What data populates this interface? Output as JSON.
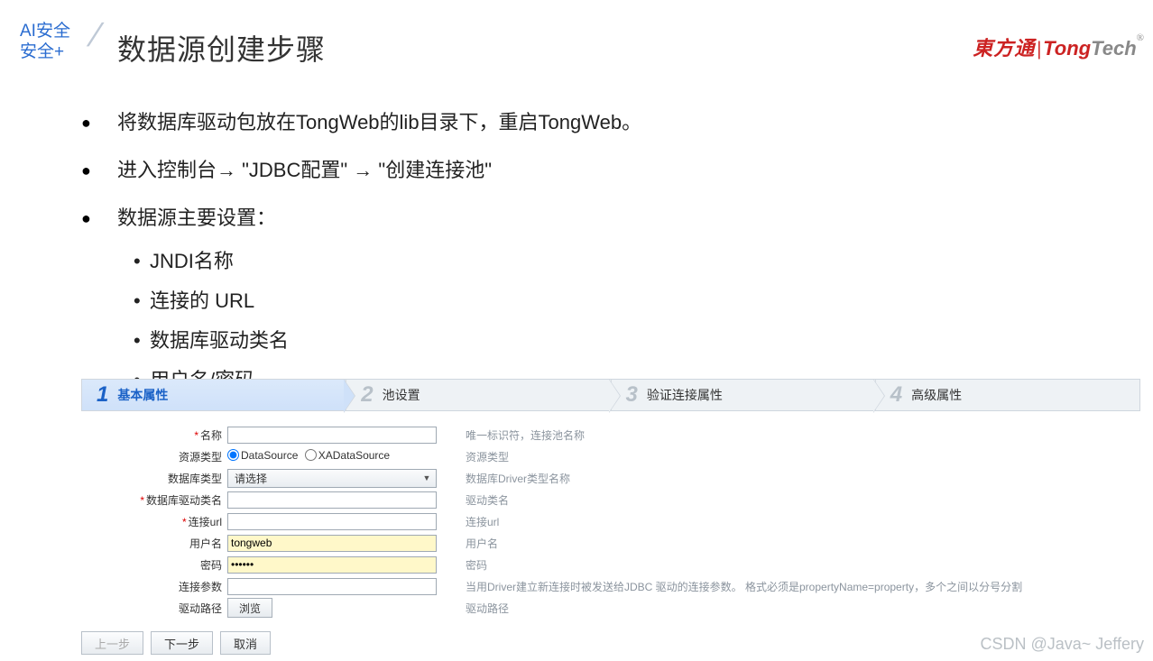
{
  "topLeft": {
    "line1": "AI安全",
    "line2": "安全+"
  },
  "title": "数据源创建步骤",
  "logo": {
    "cn": "東方通",
    "en1": "Tong",
    "en2": "Tech"
  },
  "bullets": {
    "b1": "将数据库驱动包放在TongWeb的lib目录下，重启TongWeb。",
    "b2": "进入控制台→ \"JDBC配置\" → \"创建连接池\"",
    "b3": "数据源主要设置：",
    "sub": {
      "s1": "JNDI名称",
      "s2": "连接的 URL",
      "s3": "数据库驱动类名",
      "s4": "用户名/密码"
    }
  },
  "steps": [
    {
      "num": "1",
      "label": "基本属性",
      "active": true
    },
    {
      "num": "2",
      "label": "池设置",
      "active": false
    },
    {
      "num": "3",
      "label": "验证连接属性",
      "active": false
    },
    {
      "num": "4",
      "label": "高级属性",
      "active": false
    }
  ],
  "form": {
    "name": {
      "label": "名称",
      "required": true,
      "value": "",
      "hint": "唯一标识符，连接池名称"
    },
    "resType": {
      "label": "资源类型",
      "opt1": "DataSource",
      "opt2": "XADataSource",
      "selected": "DataSource",
      "hint": "资源类型"
    },
    "dbType": {
      "label": "数据库类型",
      "value": "请选择",
      "hint": "数据库Driver类型名称"
    },
    "driverClass": {
      "label": "数据库驱动类名",
      "required": true,
      "value": "",
      "hint": "驱动类名"
    },
    "url": {
      "label": "连接url",
      "required": true,
      "value": "",
      "hint": "连接url"
    },
    "user": {
      "label": "用户名",
      "value": "tongweb",
      "hint": "用户名"
    },
    "password": {
      "label": "密码",
      "value": "••••••",
      "hint": "密码"
    },
    "connProps": {
      "label": "连接参数",
      "value": "",
      "hint": "当用Driver建立新连接时被发送给JDBC 驱动的连接参数。 格式必须是propertyName=property，多个之间以分号分割"
    },
    "driverPath": {
      "label": "驱动路径",
      "browse": "浏览",
      "hint": "驱动路径"
    }
  },
  "footer": {
    "prev": "上一步",
    "next": "下一步",
    "cancel": "取消"
  },
  "watermark": "CSDN @Java~ Jeffery"
}
